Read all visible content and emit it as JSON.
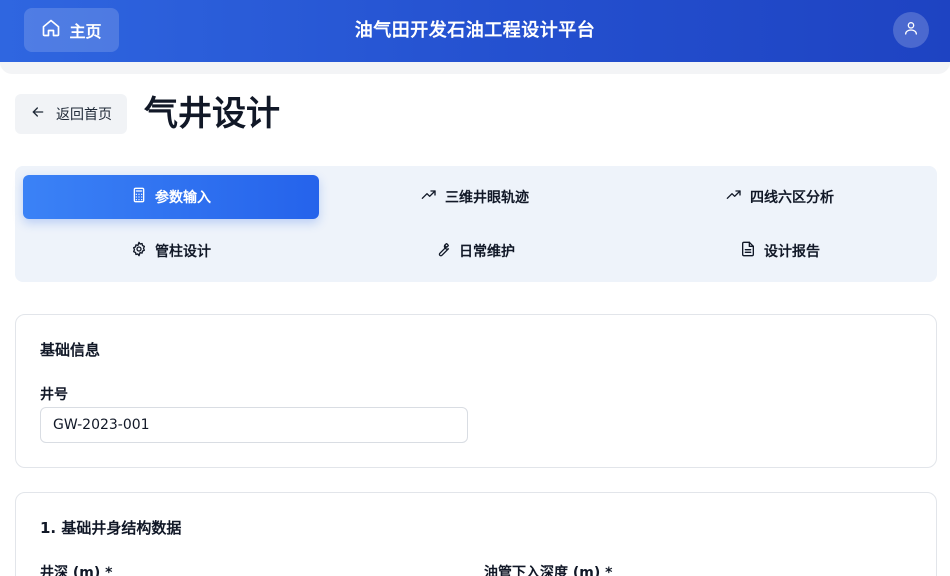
{
  "header": {
    "home_label": "主页",
    "app_title": "油气田开发石油工程设计平台"
  },
  "page": {
    "back_label": "返回首页",
    "title": "气井设计"
  },
  "tabs": [
    {
      "label": "参数输入",
      "icon": "calculator-icon",
      "active": true
    },
    {
      "label": "三维井眼轨迹",
      "icon": "trending-up-icon",
      "active": false
    },
    {
      "label": "四线六区分析",
      "icon": "trending-up-icon",
      "active": false
    },
    {
      "label": "管柱设计",
      "icon": "gear-icon",
      "active": false
    },
    {
      "label": "日常维护",
      "icon": "wrench-icon",
      "active": false
    },
    {
      "label": "设计报告",
      "icon": "document-icon",
      "active": false
    }
  ],
  "basic_info": {
    "title": "基础信息",
    "well_no_label": "井号",
    "well_no_value": "GW-2023-001"
  },
  "structure": {
    "title": "1. 基础井身结构数据",
    "depth_label": "井深 (m) *",
    "tubing_depth_label": "油管下入深度 (m) *"
  },
  "colors": {
    "header_bg": "#2450cf",
    "active_tab": "#2563eb",
    "tabs_bg": "#eef3fa"
  }
}
